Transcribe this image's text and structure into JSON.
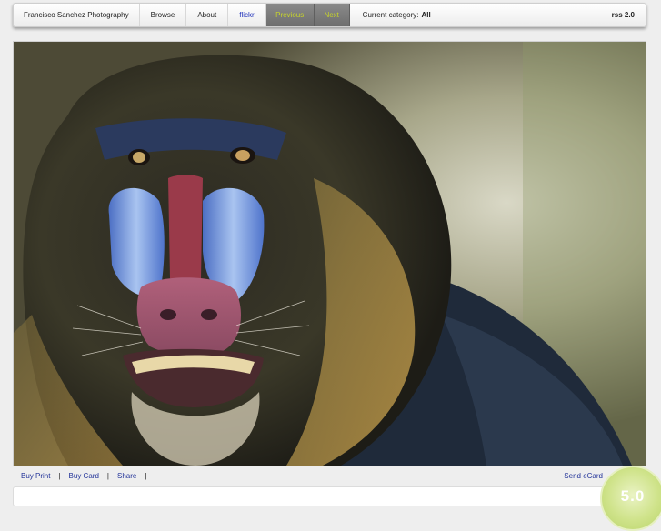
{
  "nav": {
    "site_title": "Francisco Sanchez Photography",
    "browse": "Browse",
    "about": "About",
    "flickr": "flickr",
    "previous": "Previous",
    "next": "Next",
    "category_label": "Current category:",
    "category_value": "All",
    "rss": "rss 2.0"
  },
  "actions": {
    "buy_print": "Buy Print",
    "buy_card": "Buy Card",
    "share": "Share",
    "separator": "|",
    "send_ecard": "Send eCard"
  },
  "rating": {
    "value": "5.0"
  },
  "colors": {
    "link": "#223399",
    "nav_active_bg": "#7a7a7a",
    "nav_active_text": "#c8d52a",
    "badge": "#cfe38a"
  }
}
